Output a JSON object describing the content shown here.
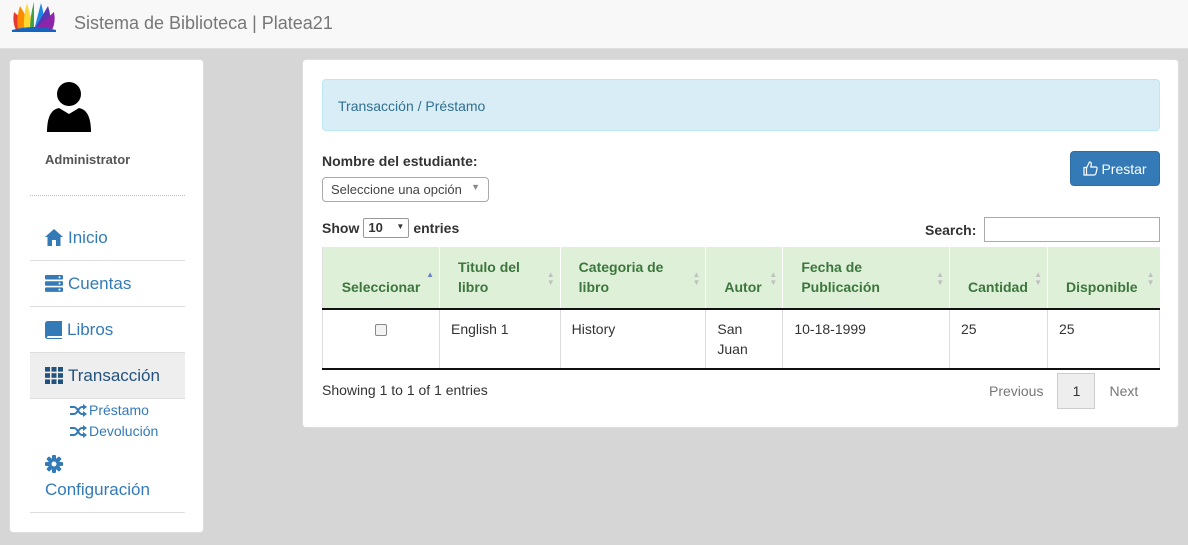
{
  "header": {
    "brand": "Sistema de Biblioteca | Platea21",
    "logo_icon": "rainbow-book-logo"
  },
  "sidebar": {
    "user_name": "Administrator",
    "nav": [
      {
        "label": "Inicio",
        "icon": "home-icon"
      },
      {
        "label": "Cuentas",
        "icon": "server-icon"
      },
      {
        "label": "Libros",
        "icon": "book-icon"
      },
      {
        "label": "Transacción",
        "icon": "grid-icon"
      }
    ],
    "sub_items": [
      {
        "label": "Préstamo",
        "icon": "shuffle-icon"
      },
      {
        "label": "Devolución",
        "icon": "shuffle-icon"
      }
    ],
    "config_label": "Configuración"
  },
  "main": {
    "breadcrumb": "Transacción / Préstamo",
    "student_label": "Nombre del estudiante:",
    "student_select_value": "Seleccione una opción",
    "prestar_label": "Prestar",
    "show_label": "Show",
    "entries_label": "entries",
    "length_value": "10",
    "search_label": "Search:",
    "search_value": "",
    "columns": [
      "Seleccionar",
      "Titulo del libro",
      "Categoria de libro",
      "Autor",
      "Fecha de Publicación",
      "Cantidad",
      "Disponible"
    ],
    "rows": [
      {
        "title": "English 1",
        "category": "History",
        "author": "San Juan",
        "date": "10-18-1999",
        "quantity": "25",
        "available": "25"
      }
    ],
    "info": "Showing 1 to 1 of 1 entries",
    "pagination": {
      "previous": "Previous",
      "page": "1",
      "next": "Next"
    }
  },
  "colors": {
    "primary": "#337ab7",
    "info_bg": "#d9edf7",
    "info_text": "#31708f",
    "header_green_bg": "#dff0d8",
    "header_green_text": "#3c763d"
  }
}
